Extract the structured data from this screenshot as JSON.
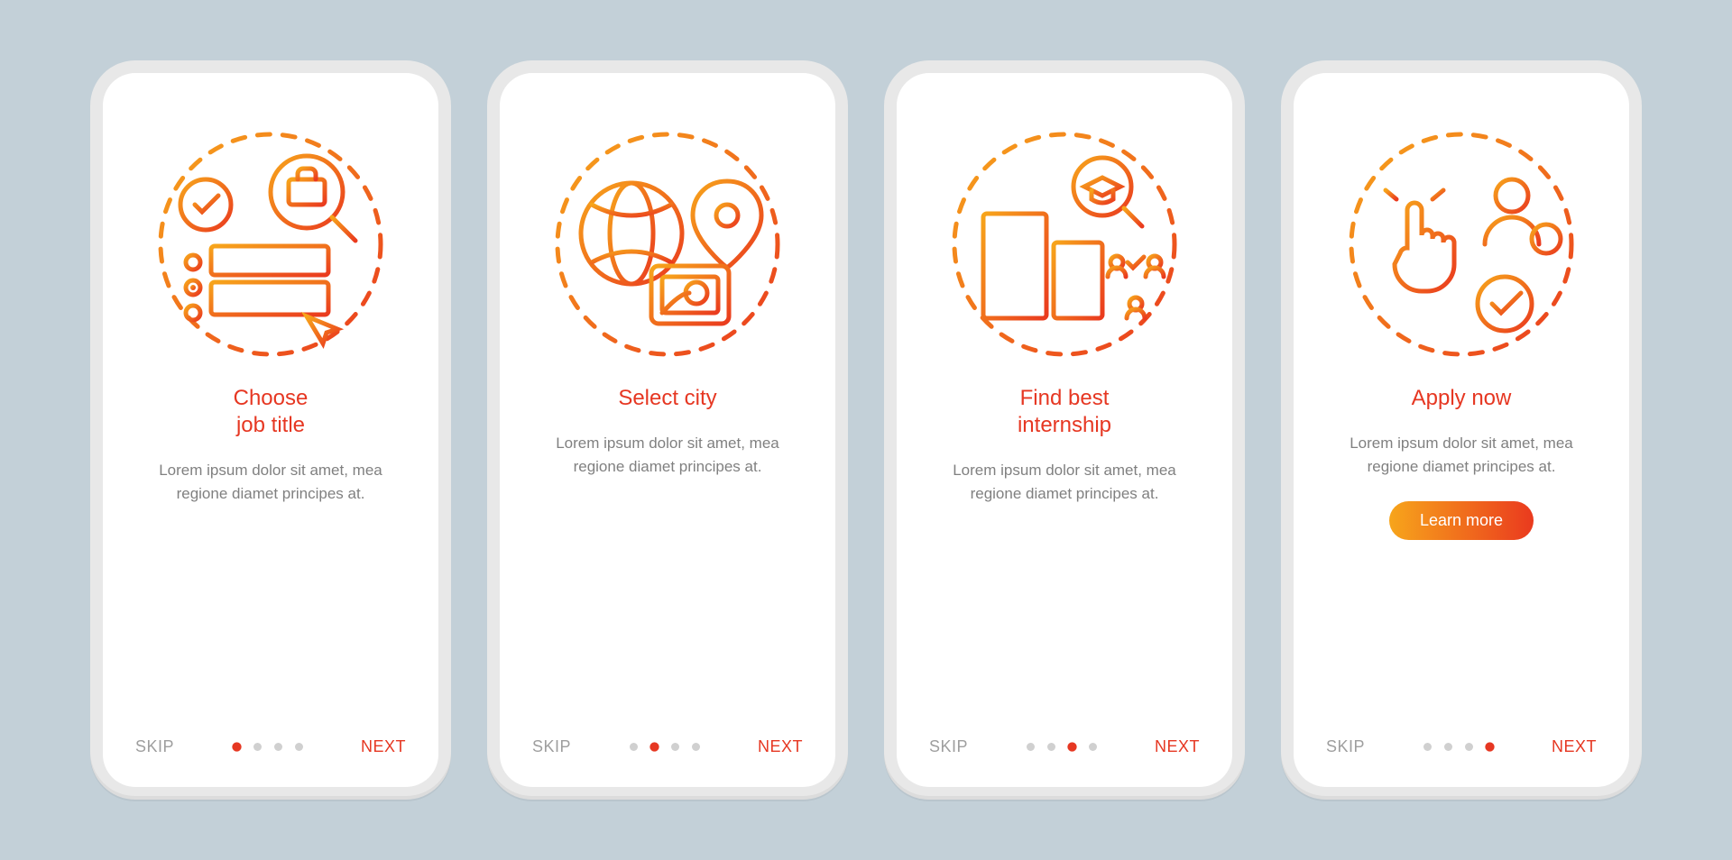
{
  "common": {
    "skip_label": "SKIP",
    "next_label": "NEXT",
    "description": "Lorem ipsum dolor sit amet, mea regione diamet principes at.",
    "colors": {
      "accent": "#e63722",
      "gradient_start": "#f7a51b",
      "gradient_end": "#ea3a1e",
      "muted": "#9e9e9e",
      "body_text": "#808080",
      "dot_inactive": "#d0d0d0"
    },
    "total_steps": 4
  },
  "screens": [
    {
      "title": "Choose\njob title",
      "icon_name": "choose-job-title-icon",
      "active_step": 0,
      "cta": null
    },
    {
      "title": "Select city",
      "icon_name": "select-city-icon",
      "active_step": 1,
      "cta": null
    },
    {
      "title": "Find best\ninternship",
      "icon_name": "find-internship-icon",
      "active_step": 2,
      "cta": null
    },
    {
      "title": "Apply now",
      "icon_name": "apply-now-icon",
      "active_step": 3,
      "cta": "Learn more"
    }
  ]
}
